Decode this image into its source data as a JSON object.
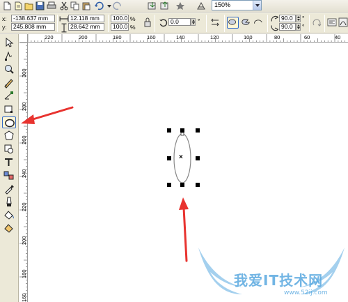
{
  "toolbar": {
    "zoom_value": "150%"
  },
  "property_bar": {
    "x_label": "x:",
    "x_value": "-138.637 mm",
    "y_label": "y:",
    "y_value": "245.808 mm",
    "width_value": "12.118 mm",
    "height_value": "28.642 mm",
    "scale_x": "100.0",
    "scale_y": "100.0",
    "pct_x": "%",
    "pct_y": "%",
    "rotation_value": "0.0",
    "rotation_unit": "°",
    "start_angle": "90.0",
    "end_angle": "90.0",
    "angle_unit": "°"
  },
  "rulers": {
    "horizontal_ticks": [
      "220",
      "200",
      "180",
      "160",
      "140",
      "120",
      "100",
      "80",
      "60",
      "40"
    ],
    "vertical_ticks": [
      "300",
      "280",
      "260",
      "240",
      "220",
      "200",
      "180",
      "160"
    ]
  },
  "toolbox": {
    "active_tool": "ellipse-tool"
  },
  "watermark": {
    "text": "我爱IT技术网",
    "url": "www.52ij.com"
  },
  "colors": {
    "arrow": "#e8332f",
    "ellipse_stroke": "#888888",
    "toolbar_bg": "#ece9d8",
    "watermark": "#5aa9e0"
  }
}
